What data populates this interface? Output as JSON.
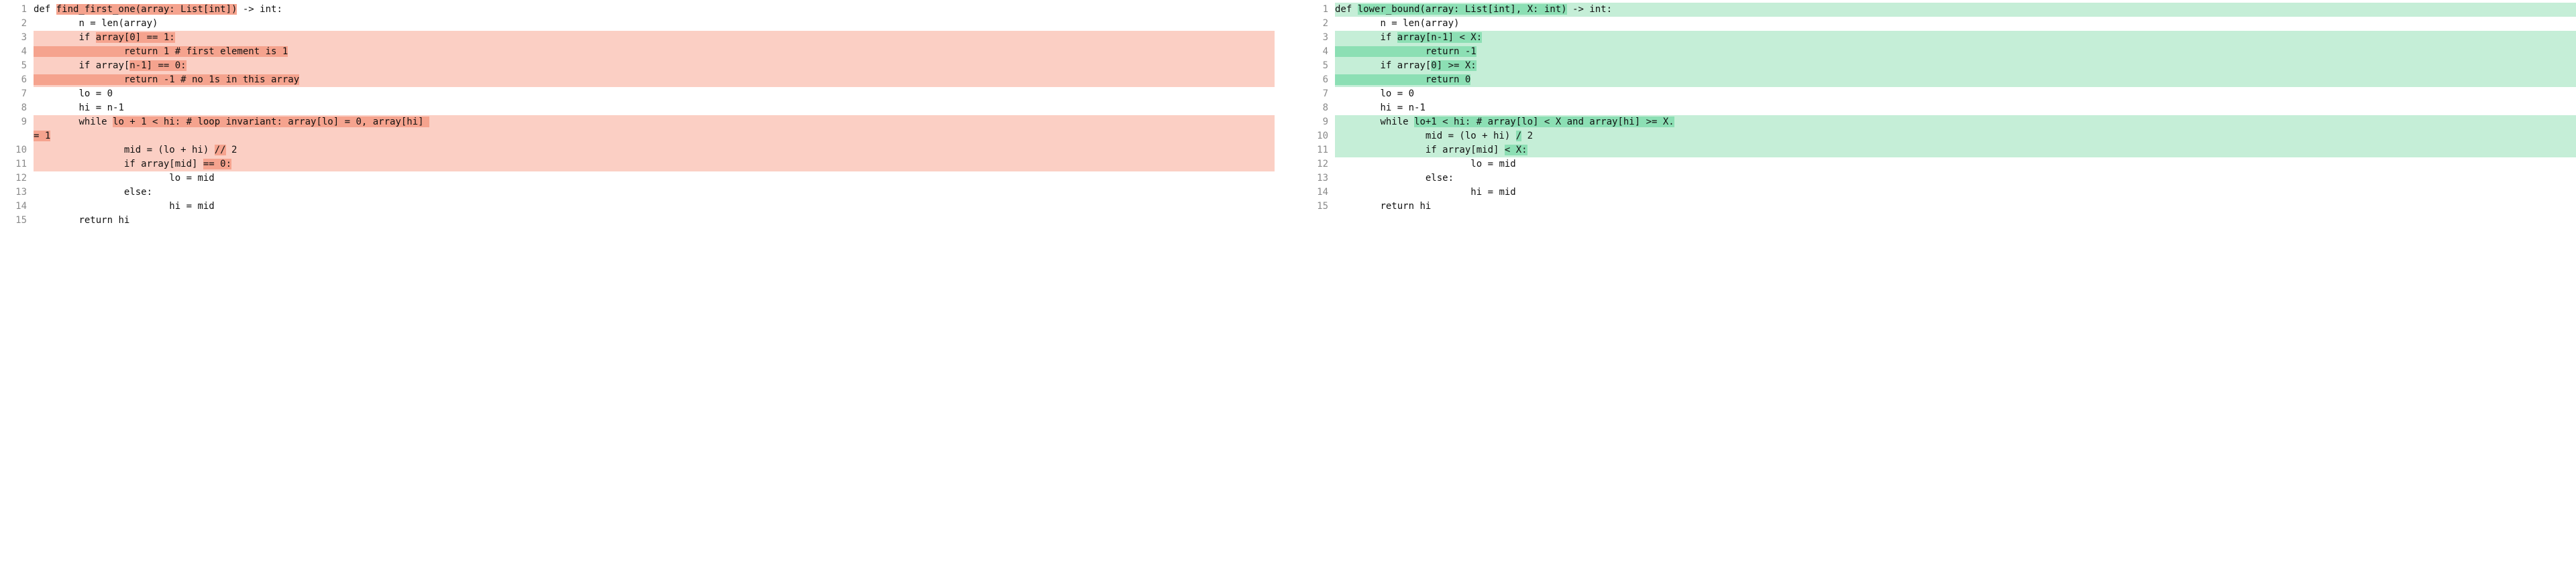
{
  "left": {
    "palette": {
      "line_bg": "#fbcfc4",
      "strong_bg": "#f5a38e"
    },
    "lines": [
      {
        "n": 1,
        "row_hl": false,
        "segs": [
          {
            "t": "def ",
            "hl": null
          },
          {
            "t": "find_first_one(array: List[int])",
            "hl": "strong"
          },
          {
            "t": " -> int:",
            "hl": null
          }
        ]
      },
      {
        "n": 2,
        "row_hl": false,
        "segs": [
          {
            "t": "        n = len(array)",
            "hl": null
          }
        ]
      },
      {
        "n": 3,
        "row_hl": "line",
        "segs": [
          {
            "t": "        if ",
            "hl": null
          },
          {
            "t": "array[0] == 1:",
            "hl": "strong"
          }
        ]
      },
      {
        "n": 4,
        "row_hl": "line",
        "segs": [
          {
            "t": "                return 1 # first element is 1",
            "hl": "strong"
          }
        ]
      },
      {
        "n": 5,
        "row_hl": "line",
        "segs": [
          {
            "t": "        if array[",
            "hl": null
          },
          {
            "t": "n-1] == 0:",
            "hl": "strong"
          }
        ]
      },
      {
        "n": 6,
        "row_hl": "line",
        "segs": [
          {
            "t": "                return -1 # no 1s in this array",
            "hl": "strong"
          }
        ]
      },
      {
        "n": 7,
        "row_hl": false,
        "segs": [
          {
            "t": "        lo = 0",
            "hl": null
          }
        ]
      },
      {
        "n": 8,
        "row_hl": false,
        "segs": [
          {
            "t": "        hi = n-1",
            "hl": null
          }
        ]
      },
      {
        "n": 9,
        "row_hl": "line",
        "wrap_tail": "= 1",
        "segs": [
          {
            "t": "        while ",
            "hl": null
          },
          {
            "t": "lo + 1 < hi: # loop invariant: array[lo] = 0, array[hi] ",
            "hl": "strong"
          }
        ]
      },
      {
        "n": 10,
        "row_hl": "line",
        "segs": [
          {
            "t": "                mid = (lo + hi) ",
            "hl": null
          },
          {
            "t": "//",
            "hl": "strong"
          },
          {
            "t": " 2",
            "hl": null
          }
        ]
      },
      {
        "n": 11,
        "row_hl": "line",
        "segs": [
          {
            "t": "                if array[mid] ",
            "hl": null
          },
          {
            "t": "== 0:",
            "hl": "strong"
          }
        ]
      },
      {
        "n": 12,
        "row_hl": false,
        "segs": [
          {
            "t": "                        lo = mid",
            "hl": null
          }
        ]
      },
      {
        "n": 13,
        "row_hl": false,
        "segs": [
          {
            "t": "                else:",
            "hl": null
          }
        ]
      },
      {
        "n": 14,
        "row_hl": false,
        "segs": [
          {
            "t": "                        hi = mid",
            "hl": null
          }
        ]
      },
      {
        "n": 15,
        "row_hl": false,
        "segs": [
          {
            "t": "        return hi",
            "hl": null
          }
        ]
      }
    ]
  },
  "right": {
    "palette": {
      "line_bg": "#c5eed7",
      "strong_bg": "#8cdfb4"
    },
    "lines": [
      {
        "n": 1,
        "row_hl": "line",
        "segs": [
          {
            "t": "def ",
            "hl": null
          },
          {
            "t": "lower_bound(array: List[int], X: int)",
            "hl": "strong"
          },
          {
            "t": " -> int:",
            "hl": null
          }
        ]
      },
      {
        "n": 2,
        "row_hl": false,
        "segs": [
          {
            "t": "        n = len(array)",
            "hl": null
          }
        ]
      },
      {
        "n": 3,
        "row_hl": "line",
        "segs": [
          {
            "t": "        if ",
            "hl": null
          },
          {
            "t": "array[n-1] < X:",
            "hl": "strong"
          }
        ]
      },
      {
        "n": 4,
        "row_hl": "line",
        "segs": [
          {
            "t": "                return -1",
            "hl": "strong"
          }
        ]
      },
      {
        "n": 5,
        "row_hl": "line",
        "segs": [
          {
            "t": "        if array[",
            "hl": null
          },
          {
            "t": "0] >= X:",
            "hl": "strong"
          }
        ]
      },
      {
        "n": 6,
        "row_hl": "line",
        "segs": [
          {
            "t": "                return 0",
            "hl": "strong"
          }
        ]
      },
      {
        "n": 7,
        "row_hl": false,
        "segs": [
          {
            "t": "        lo = 0",
            "hl": null
          }
        ]
      },
      {
        "n": 8,
        "row_hl": false,
        "segs": [
          {
            "t": "        hi = n-1",
            "hl": null
          }
        ]
      },
      {
        "n": 9,
        "row_hl": "line",
        "segs": [
          {
            "t": "        while ",
            "hl": null
          },
          {
            "t": "lo+1 < hi: # array[lo] < X and array[hi] >= X.",
            "hl": "strong"
          }
        ]
      },
      {
        "n": 10,
        "row_hl": "line",
        "segs": [
          {
            "t": "                mid = (lo + hi) ",
            "hl": null
          },
          {
            "t": "/",
            "hl": "strong"
          },
          {
            "t": " 2",
            "hl": null
          }
        ]
      },
      {
        "n": 11,
        "row_hl": "line",
        "segs": [
          {
            "t": "                if array[mid] ",
            "hl": null
          },
          {
            "t": "< X:",
            "hl": "strong"
          }
        ]
      },
      {
        "n": 12,
        "row_hl": false,
        "segs": [
          {
            "t": "                        lo = mid",
            "hl": null
          }
        ]
      },
      {
        "n": 13,
        "row_hl": false,
        "segs": [
          {
            "t": "                else:",
            "hl": null
          }
        ]
      },
      {
        "n": 14,
        "row_hl": false,
        "segs": [
          {
            "t": "                        hi = mid",
            "hl": null
          }
        ]
      },
      {
        "n": 15,
        "row_hl": false,
        "segs": [
          {
            "t": "        return hi",
            "hl": null
          }
        ]
      }
    ]
  }
}
